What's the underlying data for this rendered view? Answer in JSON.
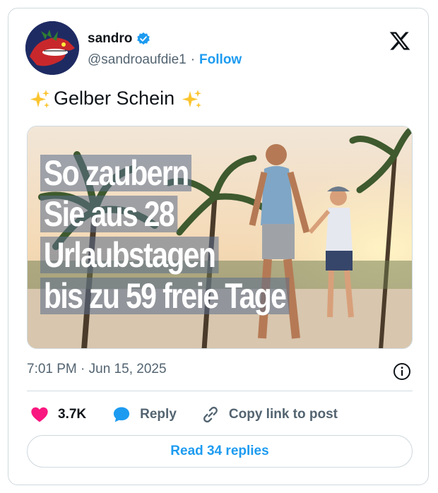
{
  "author": {
    "name": "sandro",
    "handle": "@sandroaufdie1",
    "separator": "·",
    "follow_label": "Follow"
  },
  "tweet": {
    "text": "Gelber Schein",
    "media_headline": [
      "So zaubern",
      "Sie aus 28",
      "Urlaubstagen",
      "bis zu 59 freie Tage"
    ]
  },
  "timestamp": "7:01 PM · Jun 15, 2025",
  "actions": {
    "like_count": "3.7K",
    "reply_label": "Reply",
    "copy_label": "Copy link to post"
  },
  "read_replies_label": "Read 34 replies",
  "colors": {
    "accent": "#1d9bf0",
    "like": "#f91880",
    "muted": "#536471"
  }
}
